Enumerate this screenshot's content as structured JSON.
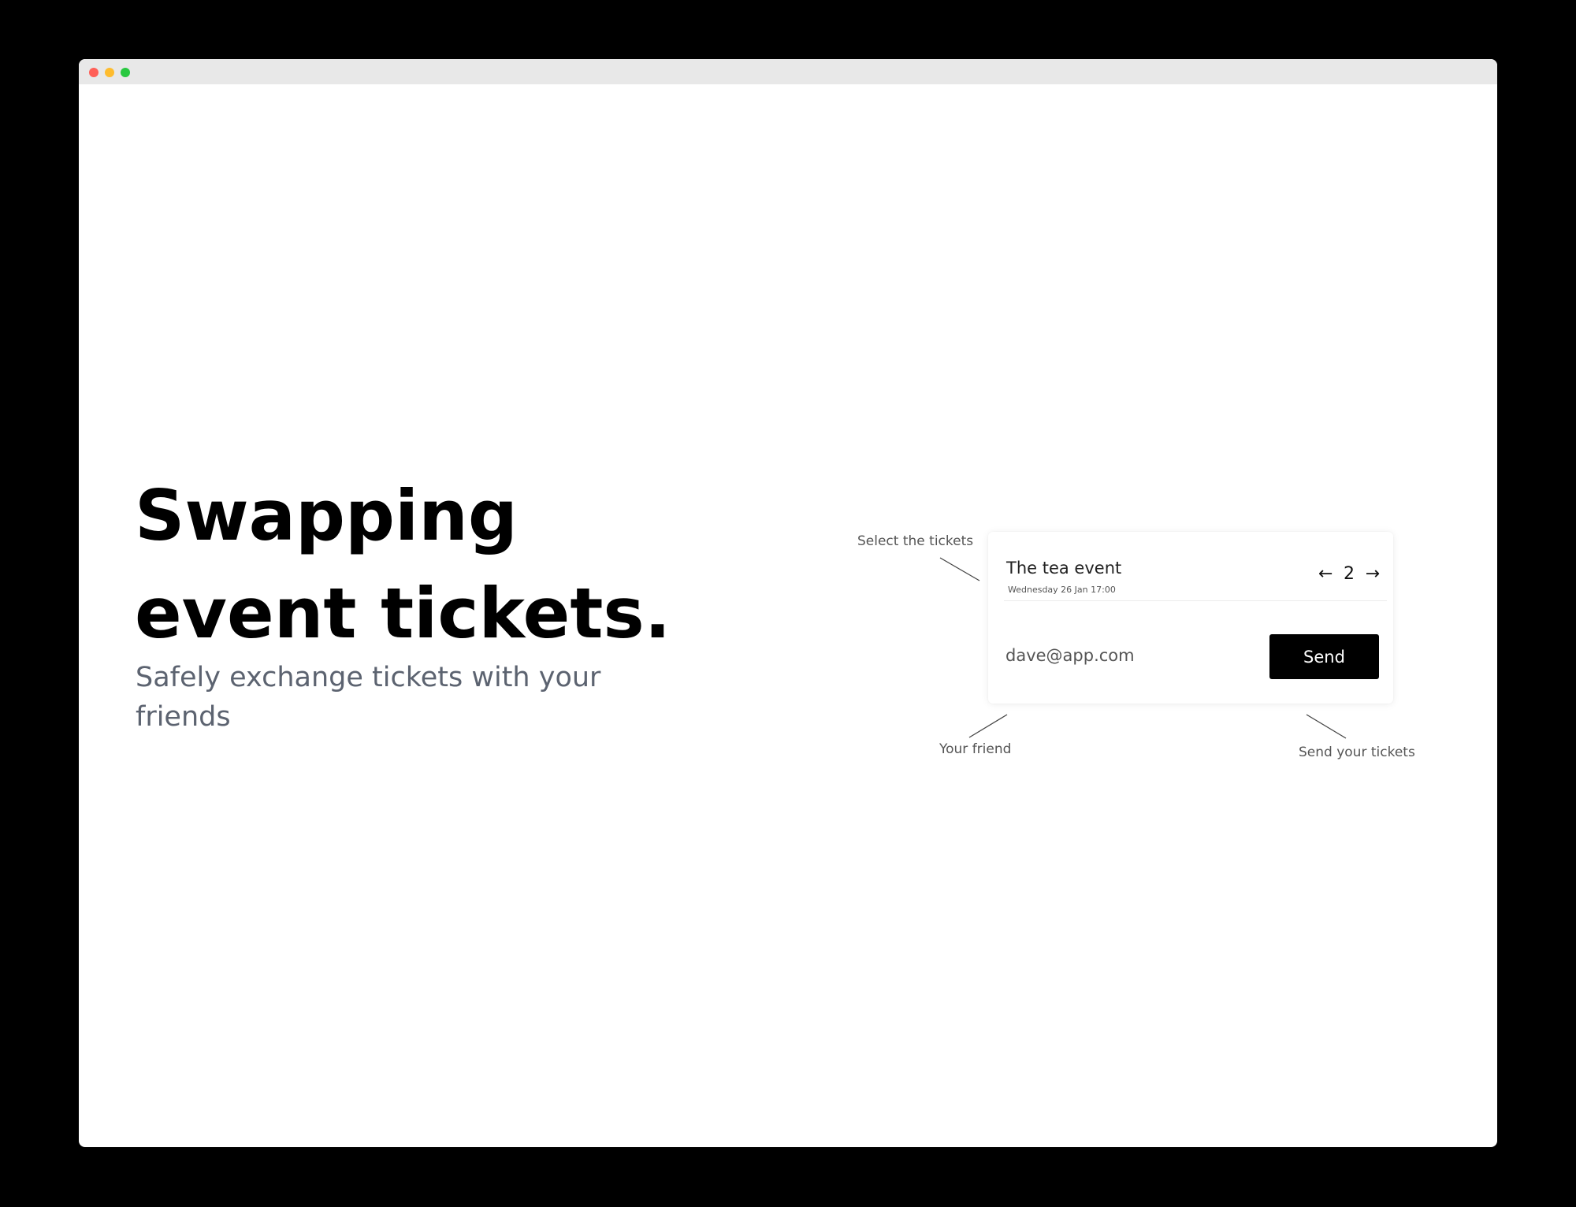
{
  "window": {
    "controls": [
      "close",
      "minimize",
      "maximize"
    ]
  },
  "hero": {
    "title_line1": "Swapping",
    "title_line2": "event tickets.",
    "subtitle": "Safely exchange tickets with your friends"
  },
  "card": {
    "event_name": "The tea event",
    "event_date": "Wednesday 26 Jan 17:00",
    "ticket_count": "2",
    "prev_glyph": "←",
    "next_glyph": "→",
    "email_placeholder": "dave@app.com",
    "send_label": "Send"
  },
  "annotations": {
    "select": "Select the tickets",
    "friend": "Your friend",
    "send": "Send your tickets"
  },
  "colors": {
    "frame": "#000000",
    "titlebar": "#e8e8e8",
    "subtitle": "#5c6370",
    "button": "#000000"
  }
}
